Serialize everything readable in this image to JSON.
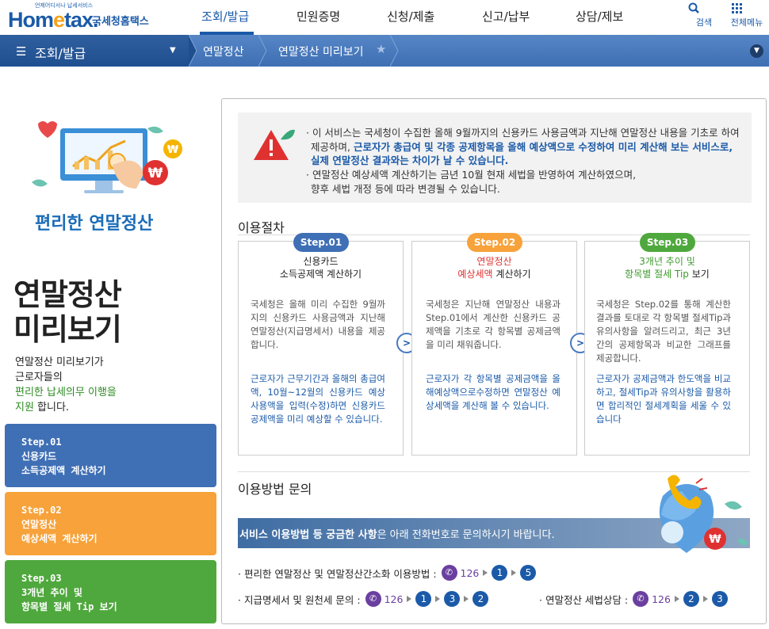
{
  "header": {
    "logo_tagline": "언제어디서나 납세서비스",
    "logo_brand_a": "Hom",
    "logo_brand_e": "e",
    "logo_brand_b": "tax.",
    "logo_site": "국세청홈택스",
    "nav": [
      "조회/발급",
      "민원증명",
      "신청/제출",
      "신고/납부",
      "상담/제보"
    ],
    "active_nav": "조회/발급",
    "search_label": "검색",
    "allmenu_label": "전체메뉴",
    "accent": "#1b5aa8"
  },
  "location": {
    "menu_label": "조회/발급",
    "crumbs": [
      "연말정산",
      "연말정산 미리보기"
    ]
  },
  "left": {
    "subtitle": "편리한 연말정산",
    "title_line1": "연말정산",
    "title_line2": "미리보기",
    "desc_1": "연말정산 미리보기가",
    "desc_2": "근로자들의",
    "desc_hl_1": "편리한 납세의무 이행을",
    "desc_hl_2": "지원",
    "desc_tail": " 합니다.",
    "steps": [
      {
        "l1": "Step.01",
        "l2": "신용카드",
        "l3": "소득공제액 계산하기",
        "color": "#3f6fb5"
      },
      {
        "l1": "Step.02",
        "l2": "연말정산",
        "l3": "예상세액 계산하기",
        "color": "#f7a23a"
      },
      {
        "l1": "Step.03",
        "l2": "3개년 추이 및",
        "l3": "항목별 절세 Tip 보기",
        "color": "#4fa83d"
      }
    ]
  },
  "notice": {
    "b1_a": "· 이 서비스는 국세청이 수집한 올해 9월까지의 신용카드 사용금액과 지난해 연말정산 내용을 기초로 하여",
    "b1_b_pre": "제공하며, ",
    "b1_b_blue": "근로자가 총급여 및 각종 공제항목을 올해 예상액으로 수정하여 미리 계산해 보는 서비스로,",
    "b1_c_blue": "실제 연말정산 결과와는 차이가 날 수 있습니다.",
    "b2_a": "· 연말정산 예상세액 계산하기는 금년 10월 현재 세법을 반영하여 계산하였으며,",
    "b2_b": "향후 세법 개정 등에 따라 변경될 수 있습니다."
  },
  "procedure": {
    "title": "이용절차",
    "cards": [
      {
        "pill": "Step.01",
        "pill_color": "#3f6fb5",
        "h1": "신용카드",
        "h1_color": "#222",
        "h2": "소득공제액 계산하기",
        "h2_color": "#222",
        "p": "국세청은 올해 미리 수집한 9월까지의 신용카드 사용금액과 지난해 연말정산(지급명세서) 내용을 제공합니다.",
        "b": "근로자가 근무기간과 올해의 총급여액, 10월~12월의 신용카드 예상 사용액을 입력(수정)하면 신용카드 공제액을 미리 예상할 수 있습니다."
      },
      {
        "pill": "Step.02",
        "pill_color": "#f7a23a",
        "h1": "연말정산",
        "h1_color": "#e03131",
        "h2a": "예상세액",
        "h2b": " 계산하기",
        "h2_color": "#e03131",
        "p": "국세청은 지난해 연말정산 내용과 Step.01에서 계산한 신용카드 공제액을 기초로 각 항목별 공제금액을 미리 채워줍니다.",
        "b": "근로자가 각 항목별 공제금액을 올해예상액으로수정하면 연말정산 예상세액을 계산해 볼 수 있습니다."
      },
      {
        "pill": "Step.03",
        "pill_color": "#4fa83d",
        "h1": "3개년 추이 및",
        "h1_color": "#3c9a2c",
        "h2a": "항목별 절세 Tip",
        "h2b": " 보기",
        "h2_color": "#3c9a2c",
        "p": "국세청은 Step.02를 통해 계산한 결과를 토대로 각 항목별 절세Tip과 유의사항을 알려드리고, 최근 3년간의 공제항목과 비교한 그래프를 제공합니다.",
        "b": "근로자가 공제금액과 한도액을 비교하고, 절세Tip과 유의사항을 활용하면 합리적인 절세계획을 세울 수 있습니다"
      }
    ]
  },
  "inquiry": {
    "title": "이용방법 문의",
    "bar_bold": "서비스 이용방법 등 궁금한 사항",
    "bar_rest": "은 아래 전화번호로 문의하시기 바랍니다.",
    "row1_label": "· 편리한 연말정산 및 연말정산간소화 이용방법 :",
    "row1_num": "126",
    "row1_steps": [
      "1",
      "5"
    ],
    "row2_label": "· 지급명세서  및 원천세 문의 :",
    "row2_num": "126",
    "row2_steps": [
      "1",
      "3",
      "2"
    ],
    "row3_label": "· 연말정산 세법상담  :",
    "row3_num": "126",
    "row3_steps": [
      "2",
      "3"
    ]
  }
}
